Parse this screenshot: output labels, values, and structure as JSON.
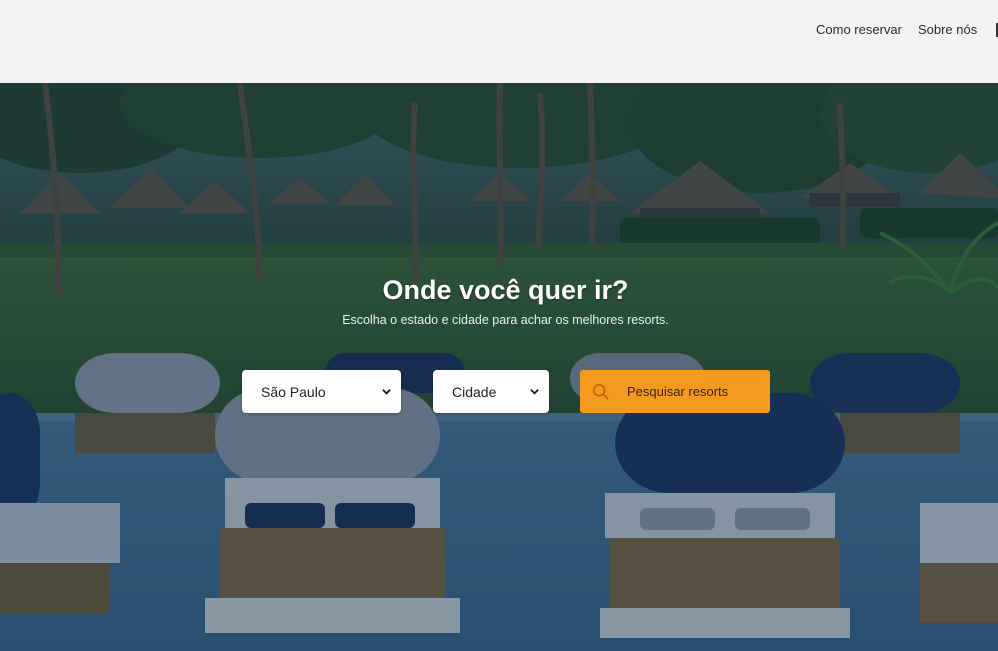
{
  "nav": {
    "items": [
      {
        "label": "Como reservar"
      },
      {
        "label": "Sobre nós"
      }
    ]
  },
  "hero": {
    "title": "Onde você quer ir?",
    "subtitle": "Escolha o estado e cidade para achar os melhores resorts."
  },
  "search": {
    "state_value": "São Paulo",
    "city_value": "Cidade",
    "button_label": "Pesquisar resorts",
    "button_icon": "search-icon"
  },
  "colors": {
    "accent": "#f39a1f",
    "topbar": "#f2f3f5",
    "overlay": "#0e2a45"
  }
}
